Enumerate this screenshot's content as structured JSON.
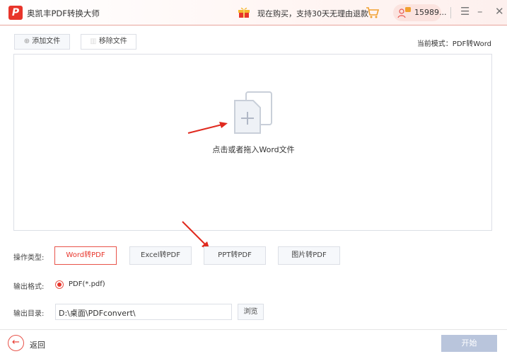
{
  "app": {
    "title": "奥凯丰PDF转换大师",
    "logo": "P"
  },
  "header": {
    "promo": "现在购买，支持30天无理由退款",
    "user": "15989...",
    "menu_icon": "☰",
    "min_icon": "–",
    "close_icon": "✕"
  },
  "toolbar": {
    "add": "添加文件",
    "remove": "移除文件",
    "mode": "当前模式：PDF转Word"
  },
  "drop": {
    "text": "点击或者拖入Word文件"
  },
  "options": {
    "op_label": "操作类型:",
    "ops": [
      "Word转PDF",
      "Excel转PDF",
      "PPT转PDF",
      "图片转PDF"
    ],
    "format_label": "输出格式:",
    "format": "PDF(*.pdf)",
    "dir_label": "输出目录:",
    "dir": "D:\\桌面\\PDFconvert\\",
    "browse": "浏览"
  },
  "footer": {
    "back": "返回",
    "start": "开始"
  },
  "colors": {
    "accent": "#e8352b",
    "start": "#b9c5dc"
  }
}
